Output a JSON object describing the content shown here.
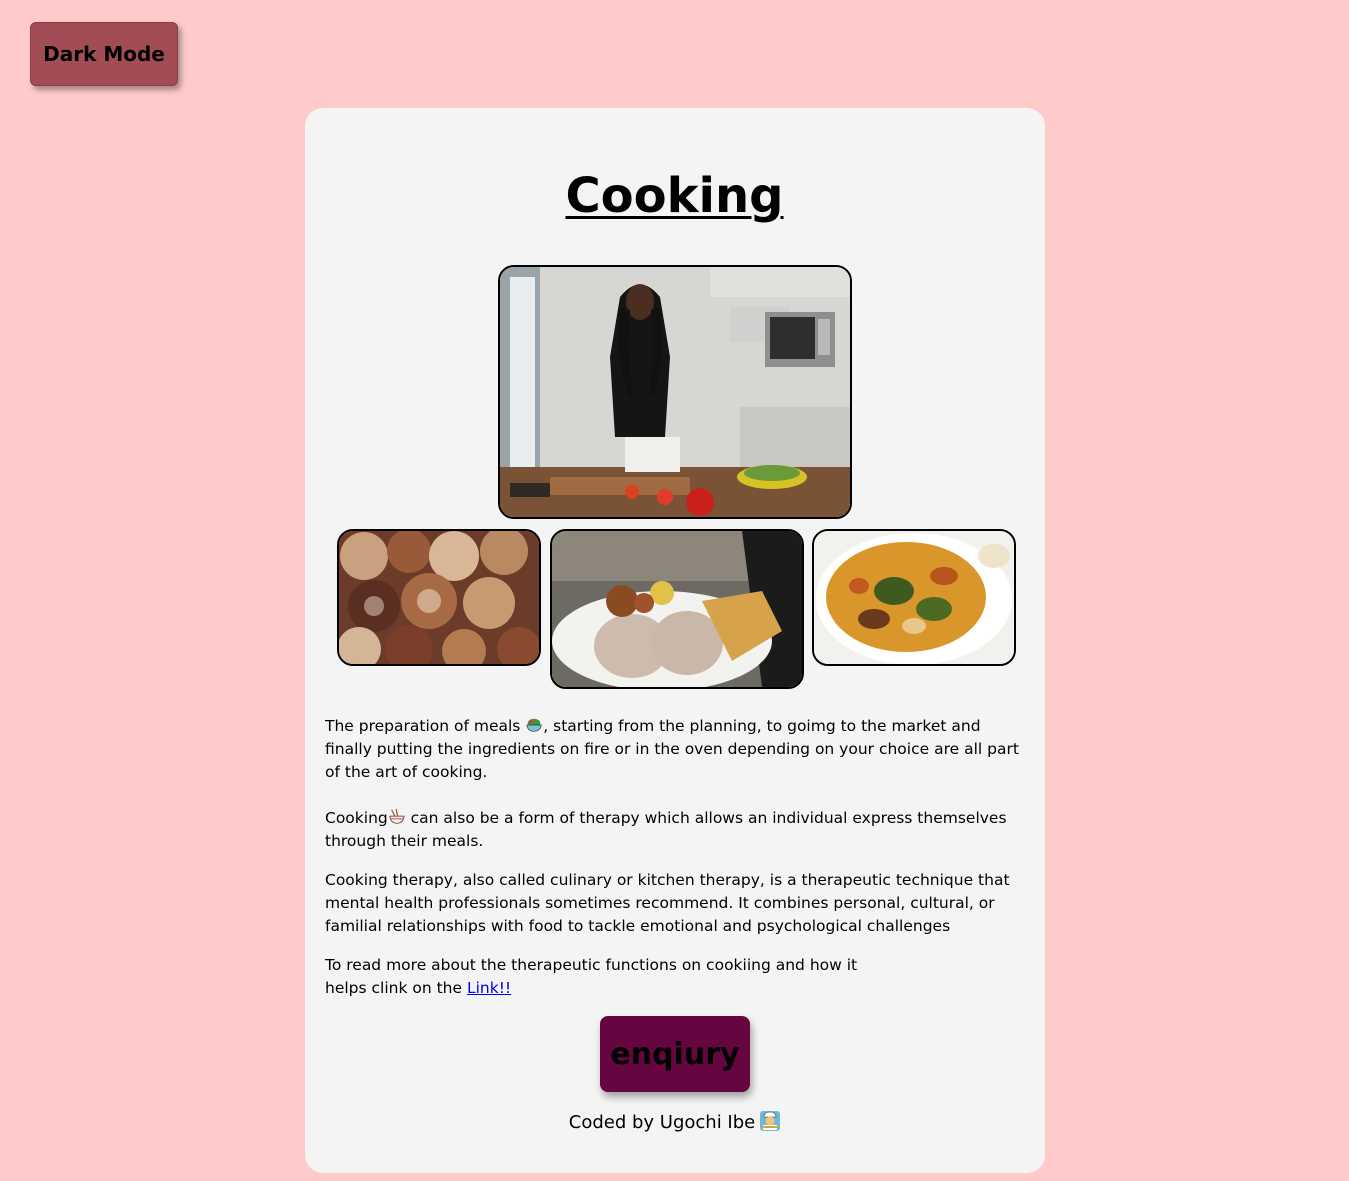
{
  "controls": {
    "dark_mode_label": "Dark Mode"
  },
  "main": {
    "title": "Cooking",
    "images": [
      {
        "name": "kitchen-cooking-photo",
        "alt": "Woman cutting vegetables in kitchen"
      },
      {
        "name": "bread-pastries-photo",
        "alt": "Assorted breads and pastries"
      },
      {
        "name": "rice-dish-photo",
        "alt": "Plate of rice with stew"
      },
      {
        "name": "soup-dish-photo",
        "alt": "Bowl of vegetable soup"
      }
    ],
    "paragraph1": {
      "text_before": "The preparation of meals ",
      "emoji": "salad-bowl-icon",
      "text_after": ", starting from the planning, to goimg to the market and finally putting the ingredients on fire or in the oven depending on your choice are all part of the art of cooking."
    },
    "paragraph2": {
      "text_before": "Cooking",
      "emoji": "noodle-bowl-icon",
      "text_after": " can also be a form of therapy which allows an individual express themselves through their meals."
    },
    "paragraph3": "Cooking therapy, also called culinary or kitchen therapy, is a therapeutic technique that mental health professionals sometimes recommend. It combines personal, cultural, or familial relationships with food to tackle emotional and psychological challenges",
    "paragraph4": {
      "text_before": "To read more about the therapeutic functions on cookiing and how it helps clink on the ",
      "link_label": "Link!!"
    },
    "enquiry_label": "enqiury",
    "footer": {
      "text": "Coded by Ugochi Ibe",
      "emoji": "cook-icon"
    }
  },
  "colors": {
    "page_background": "#ffcaca",
    "card_background": "#f4f4f4",
    "dark_mode_button": "#a24d55",
    "enquiry_button": "#650641",
    "link": "#0000ee"
  }
}
